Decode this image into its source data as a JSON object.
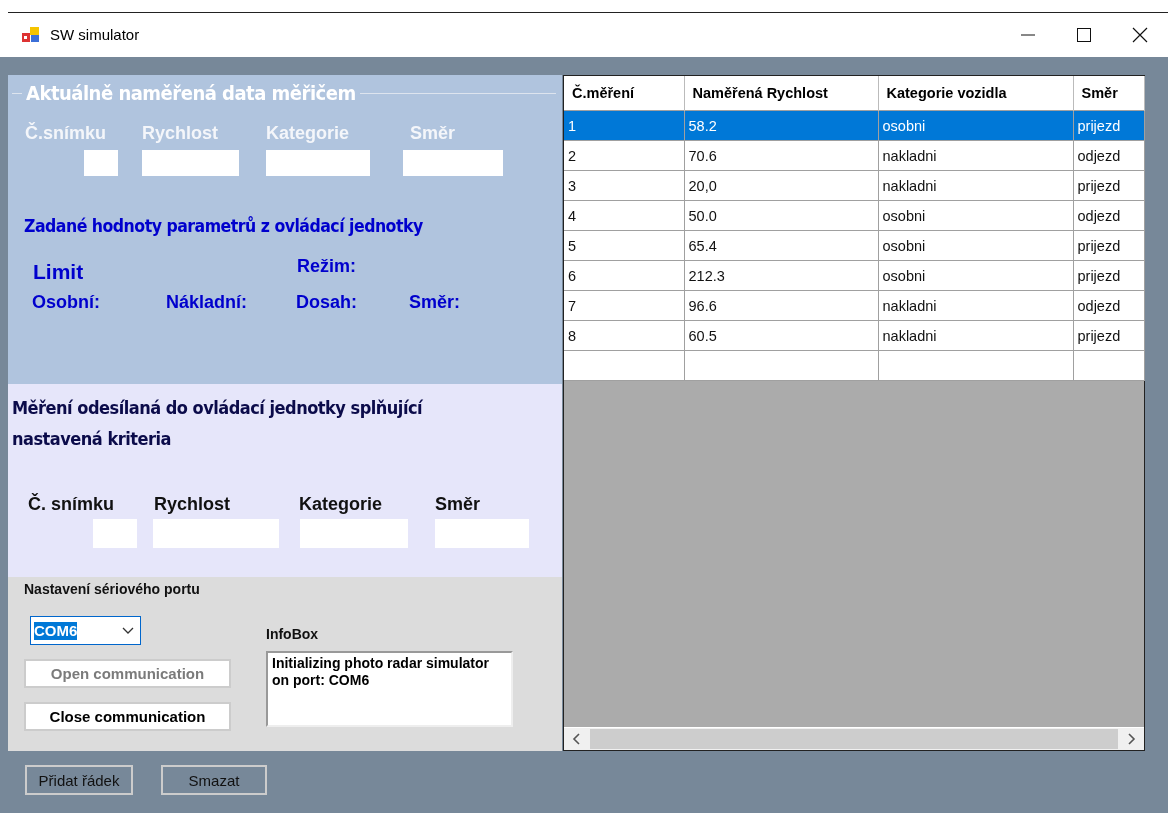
{
  "window": {
    "title": "SW simulator"
  },
  "measured": {
    "title": "Aktuálně naměřená data měřičem",
    "labels": [
      "Č.snímku",
      "Rychlost",
      "Kategorie",
      "Směr"
    ]
  },
  "parameters": {
    "title": "Zadané hodnoty parametrů z ovládací jednotky",
    "labels": [
      "Limit",
      "Režim:",
      "Osobní:",
      "Nákladní:",
      "Dosah:",
      "Směr:"
    ]
  },
  "sent": {
    "title": "Měření odesílaná do ovládací jednotky splňující nastavená kriteria",
    "labels": [
      "Č. snímku",
      "Rychlost",
      "Kategorie",
      "Směr"
    ]
  },
  "serial": {
    "title": "Nastavení sériového portu",
    "port": {
      "value": "COM6"
    },
    "buttons": [
      {
        "label": "Open communication",
        "disabled": true
      },
      {
        "label": "Close communication",
        "disabled": false
      }
    ],
    "infobox": {
      "label": "InfoBox",
      "text": "Initializing photo radar simulator on port: COM6"
    }
  },
  "table": {
    "columns": [
      "Č.měření",
      "Naměřená Rychlost",
      "Kategorie vozidla",
      "Směr"
    ],
    "rows": [
      {
        "cells": [
          "1",
          "58.2",
          "osobni",
          "prijezd"
        ],
        "selected": true
      },
      {
        "cells": [
          "2",
          "70.6",
          "nakladni",
          "odjezd"
        ],
        "selected": false
      },
      {
        "cells": [
          "3",
          "20,0",
          "nakladni",
          "prijezd"
        ],
        "selected": false
      },
      {
        "cells": [
          "4",
          "50.0",
          "osobni",
          "odjezd"
        ],
        "selected": false
      },
      {
        "cells": [
          "5",
          "65.4",
          "osobni",
          "prijezd"
        ],
        "selected": false
      },
      {
        "cells": [
          "6",
          "212.3",
          "osobni",
          "prijezd"
        ],
        "selected": false
      },
      {
        "cells": [
          "7",
          "96.6",
          "nakladni",
          "odjezd"
        ],
        "selected": false
      },
      {
        "cells": [
          "8",
          "60.5",
          "nakladni",
          "prijezd"
        ],
        "selected": false
      }
    ]
  },
  "buttons": [
    {
      "label": "Přidat řádek"
    },
    {
      "label": "Smazat"
    }
  ]
}
